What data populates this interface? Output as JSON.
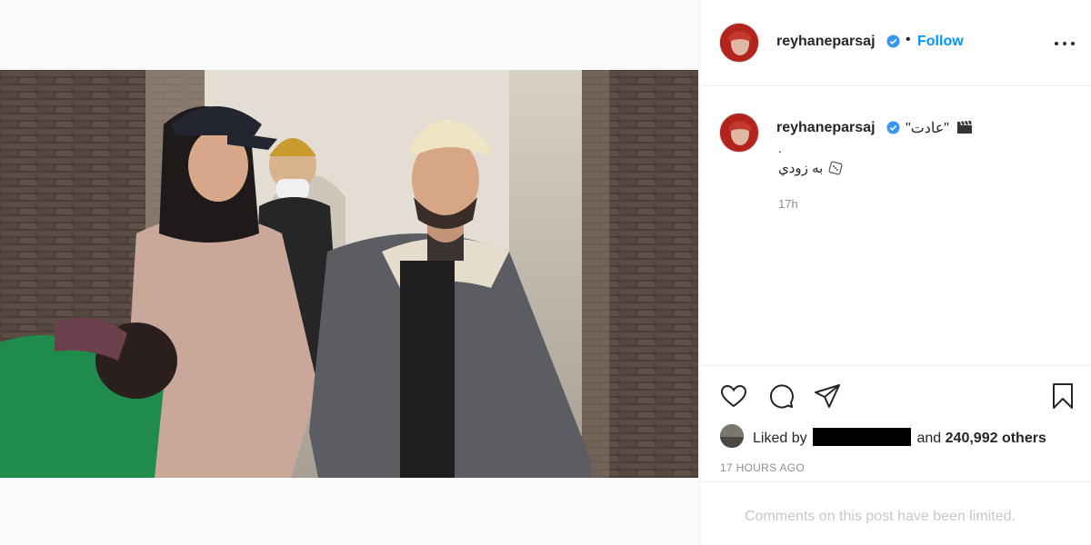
{
  "post": {
    "username": "reyhaneparsaj",
    "follow_label": "Follow",
    "separator": "•",
    "caption_title": "\"عادت\"",
    "caption_dot": ".",
    "caption_line2": "به زودي",
    "caption_time": "17h",
    "liked_by_prefix": "Liked by",
    "liked_by_and": "and",
    "likes_count": "240,992 others",
    "post_time": "17 HOURS AGO",
    "comments_notice": "Comments on this post have been limited."
  },
  "icons": {
    "verified": "verified-badge-icon",
    "more": "more-options-icon",
    "like": "heart-icon",
    "comment": "comment-icon",
    "share": "share-icon",
    "save": "bookmark-icon",
    "clapper": "clapper-board-icon",
    "dice": "dice-icon"
  },
  "colors": {
    "accent": "#0095f6",
    "text": "#262626",
    "muted": "#8e8e8e",
    "limited": "#c7c7c7"
  }
}
